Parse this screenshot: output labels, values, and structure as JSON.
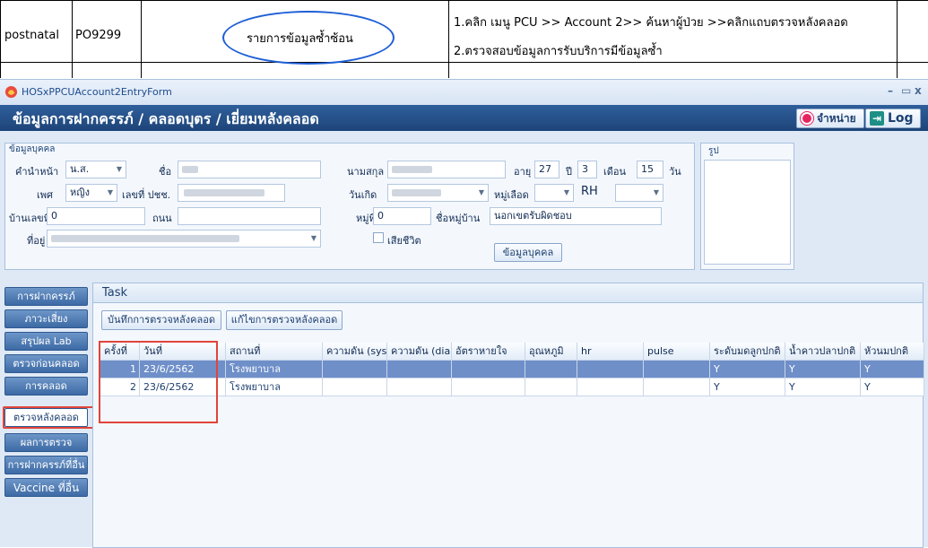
{
  "doc_row": {
    "type": "postnatal",
    "code": "PO9299",
    "issue": "รายการข้อมูลซ้ำซ้อน",
    "steps": [
      "1.คลิก เมนู PCU >> Account 2>> ค้นหาผู้ป่วย >>คลิกแถบตรวจหลังคลอด",
      "2.ตรวจสอบข้อมูลการรับบริการมีข้อมูลซ้ำ"
    ]
  },
  "window": {
    "title": "HOSxPPCUAccount2EntryForm",
    "header": "ข้อมูลการฝากครรภ์ / คลอดบุตร / เยี่ยมหลังคลอด",
    "distribute_label": "จำหน่าย",
    "log_label": "Log"
  },
  "person": {
    "legend": "ข้อมูลบุคคล",
    "prefix_label": "คำนำหน้า",
    "prefix_value": "น.ส.",
    "name_label": "ชื่อ",
    "surname_label": "นามสกุล",
    "age_label": "อายุ",
    "age_years": "27",
    "years_label": "ปี",
    "age_months": "3",
    "months_label": "เดือน",
    "age_days": "15",
    "days_label": "วัน",
    "sex_label": "เพศ",
    "sex_value": "หญิง",
    "cid_label": "เลขที่ ปชช.",
    "birthdate_label": "วันเกิด",
    "blood_label": "หมู่เลือด",
    "rh_label": "RH",
    "house_no_label": "บ้านเลขที่",
    "house_no_value": "0",
    "road_label": "ถนน",
    "moo_label": "หมู่ที่",
    "moo_value": "0",
    "village_label": "ชื่อหมู่บ้าน",
    "village_value": "นอกเขตรับผิดชอบ",
    "address_label": "ที่อยู่",
    "deceased_label": "เสียชีวิต",
    "info_button": "ข้อมูลบุคคล"
  },
  "photo": {
    "legend": "รูป"
  },
  "nav": [
    "การฝากครรภ์",
    "ภาวะเสี่ยง",
    "สรุปผล Lab",
    "ตรวจก่อนคลอด",
    "การคลอด",
    "ตรวจหลังคลอด",
    "ผลการตรวจ",
    "การฝากครรภ์ที่อื่น",
    "Vaccine ที่อื่น"
  ],
  "nav_active_index": 5,
  "task": {
    "title": "Task",
    "save_button": "บันทึกการตรวจหลังคลอด",
    "edit_button": "แก้ไขการตรวจหลังคลอด",
    "columns": [
      "ครั้งที่",
      "วันที่",
      "สถานที่",
      "ความดัน (sys",
      "ความดัน (dia",
      "อัตราหายใจ",
      "อุณหภูมิ",
      "hr",
      "pulse",
      "ระดับมดลูกปกติ",
      "น้ำคาวปลาปกติ",
      "หัวนมปกติ"
    ],
    "rows": [
      [
        "1",
        "23/6/2562",
        "โรงพยาบาล",
        "",
        "",
        "",
        "",
        "",
        "",
        "Y",
        "Y",
        "Y"
      ],
      [
        "2",
        "23/6/2562",
        "โรงพยาบาล",
        "",
        "",
        "",
        "",
        "",
        "",
        "Y",
        "Y",
        "Y"
      ]
    ]
  },
  "colors": {
    "header_bg": "#1d4478",
    "selected_row": "#6f8fc9",
    "highlight_box": "#e0443a",
    "annotation_oval": "#1f5fd6"
  }
}
